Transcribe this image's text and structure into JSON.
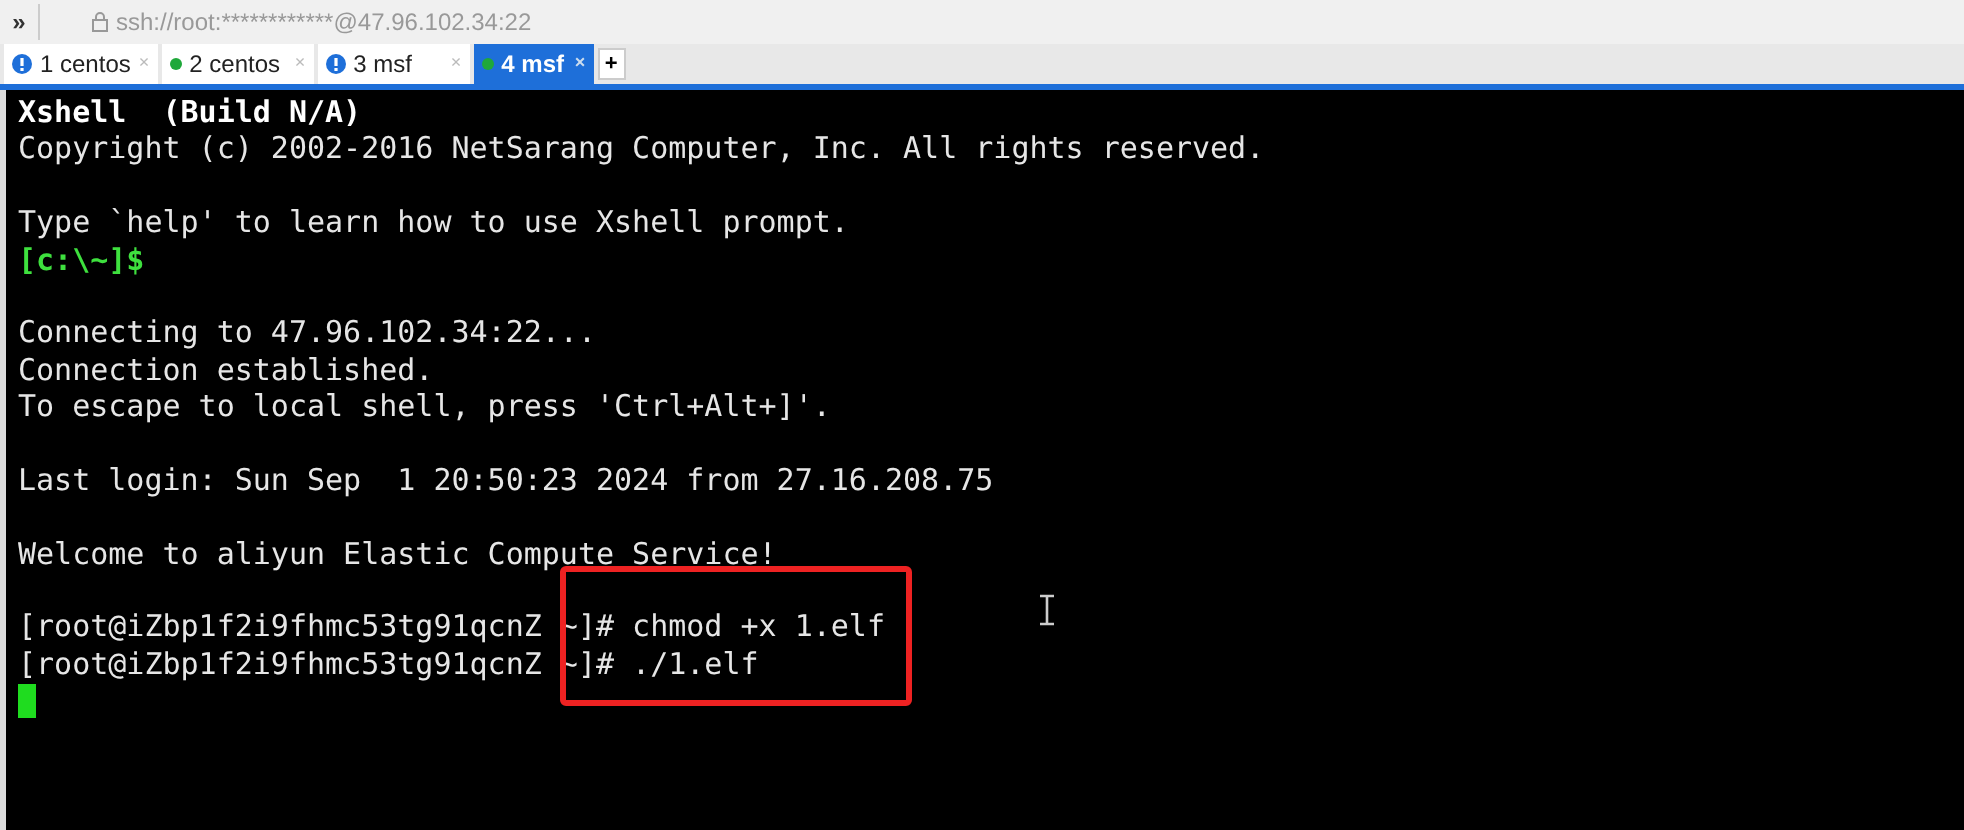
{
  "toolbar": {
    "chevron": "»",
    "address": "ssh://root:************@47.96.102.34:22"
  },
  "tabs": [
    {
      "label": "1 centos",
      "kind": "alert",
      "selected": false,
      "close": "×"
    },
    {
      "label": "2 centos",
      "kind": "connected",
      "selected": false,
      "close": "×"
    },
    {
      "label": "3 msf",
      "kind": "alert",
      "selected": false,
      "close": "×"
    },
    {
      "label": "4 msf",
      "kind": "connected",
      "selected": true,
      "close": "×"
    }
  ],
  "new_tab": "+",
  "terminal": {
    "lines": [
      {
        "kind": "bold",
        "text": "Xshell  (Build N/A)"
      },
      {
        "kind": "normal",
        "text": "Copyright (c) 2002-2016 NetSarang Computer, Inc. All rights reserved."
      },
      {
        "kind": "blank"
      },
      {
        "kind": "normal",
        "text": "Type `help' to learn how to use Xshell prompt."
      },
      {
        "kind": "prompt",
        "text": "[c:\\~]$"
      },
      {
        "kind": "blank"
      },
      {
        "kind": "normal",
        "text": "Connecting to 47.96.102.34:22..."
      },
      {
        "kind": "normal",
        "text": "Connection established."
      },
      {
        "kind": "normal",
        "text": "To escape to local shell, press 'Ctrl+Alt+]'."
      },
      {
        "kind": "blank"
      },
      {
        "kind": "normal",
        "text": "Last login: Sun Sep  1 20:50:23 2024 from 27.16.208.75"
      },
      {
        "kind": "blank"
      },
      {
        "kind": "normal",
        "text": "Welcome to aliyun Elastic Compute Service!"
      },
      {
        "kind": "blank"
      },
      {
        "kind": "normal",
        "text": "[root@iZbp1f2i9fhmc53tg91qcnZ ~]# chmod +x 1.elf"
      },
      {
        "kind": "normal",
        "text": "[root@iZbp1f2i9fhmc53tg91qcnZ ~]# ./1.elf"
      },
      {
        "kind": "cursor"
      }
    ]
  }
}
